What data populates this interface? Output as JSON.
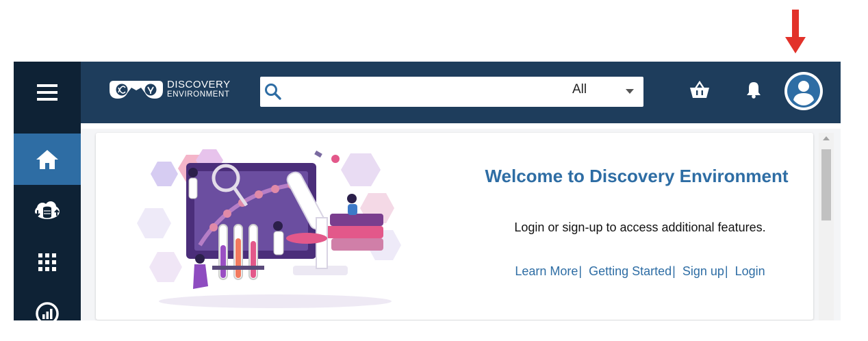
{
  "header": {
    "logo_line1": "DISCOVERY",
    "logo_line2": "ENVIRONMENT",
    "search": {
      "value": "",
      "placeholder": "",
      "scope_selected": "All"
    }
  },
  "sidebar": {
    "items": [
      {
        "icon": "home-icon",
        "active": true
      },
      {
        "icon": "data-cloud-icon",
        "active": false
      },
      {
        "icon": "apps-grid-icon",
        "active": false
      },
      {
        "icon": "analyses-icon",
        "active": false
      }
    ]
  },
  "welcome": {
    "title": "Welcome to Discovery Environment",
    "subtitle": "Login or sign-up to access additional features.",
    "links": [
      {
        "label": "Learn More"
      },
      {
        "label": "Getting Started"
      },
      {
        "label": "Sign up"
      },
      {
        "label": "Login"
      }
    ],
    "separator": "|"
  },
  "annotation": {
    "color": "#e2322a",
    "highlights": "account-button"
  },
  "colors": {
    "sidebar_bg": "#0e2235",
    "topbar_bg": "#1e3d5c",
    "accent": "#2e6da4"
  }
}
